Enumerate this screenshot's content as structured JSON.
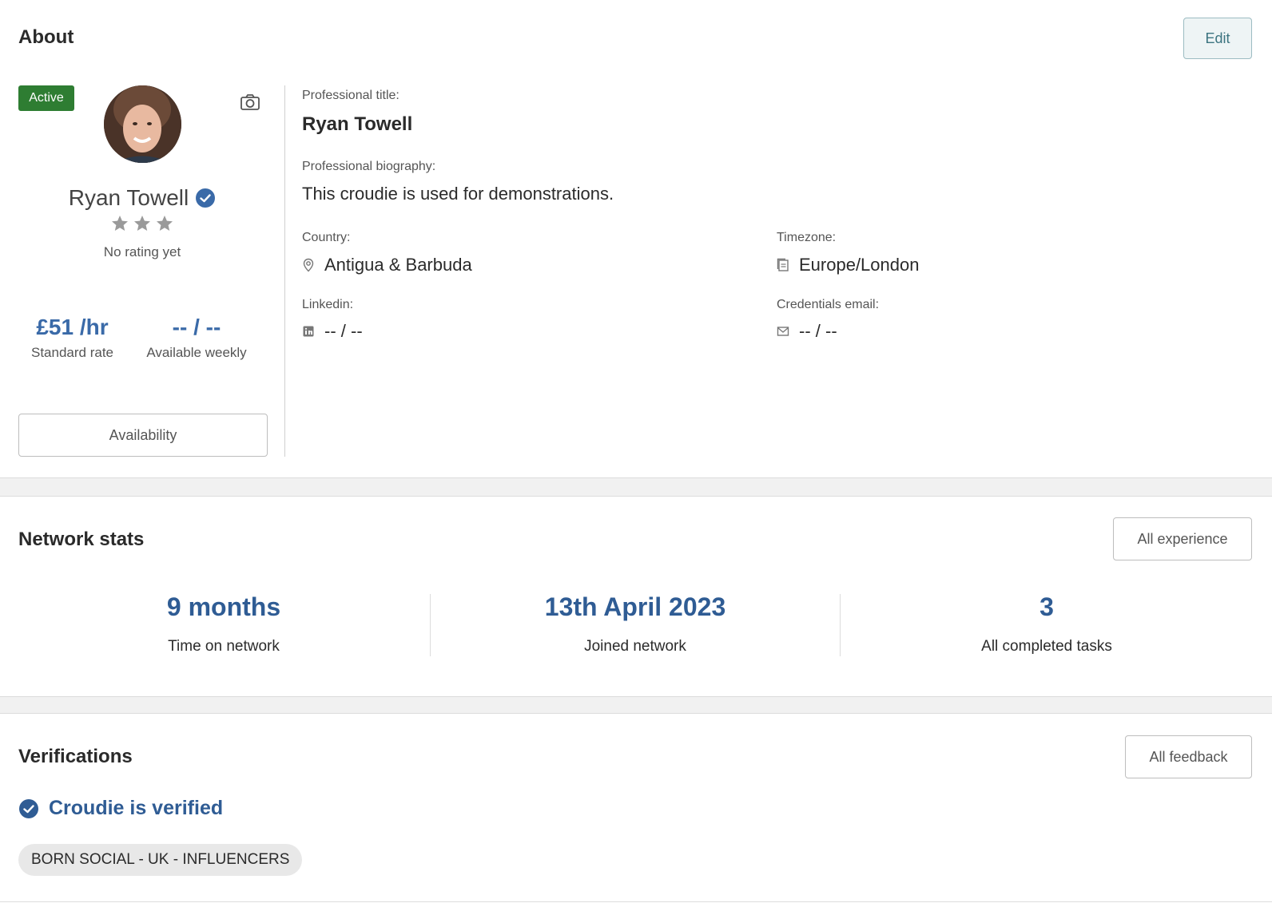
{
  "about": {
    "title": "About",
    "edit_label": "Edit",
    "status_badge": "Active",
    "profile_name": "Ryan Towell",
    "rating_text": "No rating yet",
    "rating_stars": 3,
    "standard_rate_value": "£51 /hr",
    "standard_rate_label": "Standard rate",
    "available_weekly_value": "-- / --",
    "available_weekly_label": "Available weekly",
    "availability_button": "Availability",
    "professional_title_label": "Professional title:",
    "professional_title_value": "Ryan Towell",
    "biography_label": "Professional biography:",
    "biography_value": "This croudie is used for demonstrations.",
    "country_label": "Country:",
    "country_value": "Antigua & Barbuda",
    "timezone_label": "Timezone:",
    "timezone_value": "Europe/London",
    "linkedin_label": "Linkedin:",
    "linkedin_value": "-- / --",
    "credentials_email_label": "Credentials email:",
    "credentials_email_value": "-- / --"
  },
  "network_stats": {
    "title": "Network stats",
    "all_experience_label": "All experience",
    "stats": [
      {
        "value": "9 months",
        "label": "Time on network"
      },
      {
        "value": "13th April 2023",
        "label": "Joined network"
      },
      {
        "value": "3",
        "label": "All completed tasks"
      }
    ]
  },
  "verifications": {
    "title": "Verifications",
    "all_feedback_label": "All feedback",
    "verified_text": "Croudie is verified",
    "tags": [
      "BORN SOCIAL - UK - INFLUENCERS"
    ]
  },
  "colors": {
    "accent_blue": "#2f5c94",
    "active_green": "#2e7d32",
    "star_grey": "#9a9a9a"
  }
}
